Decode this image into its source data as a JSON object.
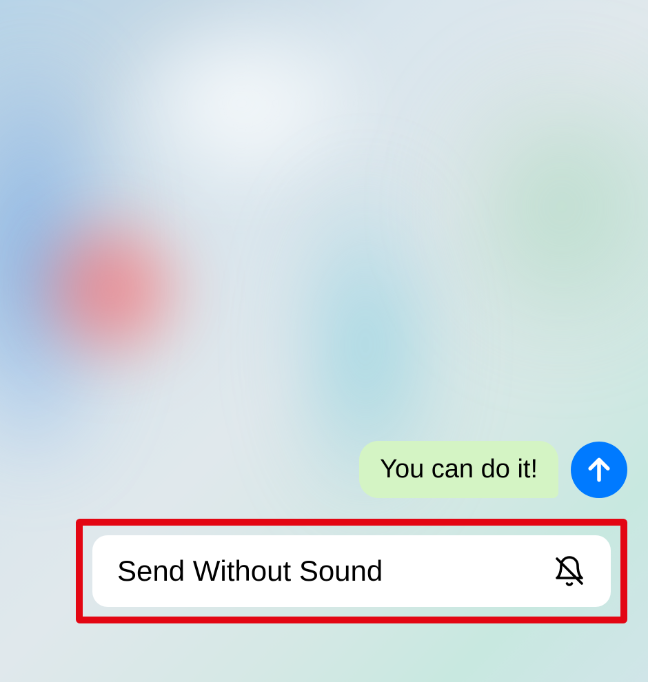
{
  "chat": {
    "message_text": "You can do it!"
  },
  "send_options": {
    "send_without_sound_label": "Send Without Sound"
  },
  "colors": {
    "send_button": "#007aff",
    "message_bubble": "#d4f4c4",
    "highlight_border": "#e30613"
  }
}
